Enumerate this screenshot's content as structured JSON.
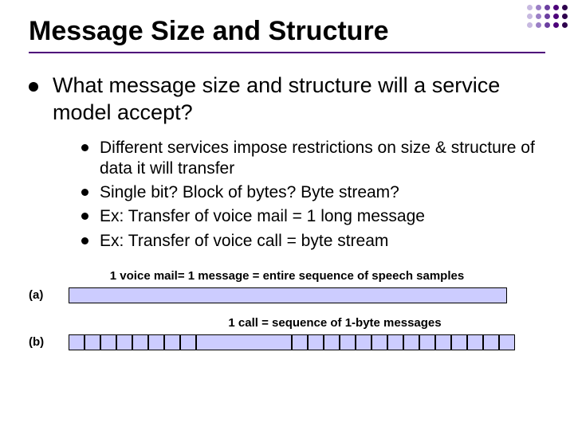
{
  "title": "Message Size and Structure",
  "main_bullet": "What message size and structure will a service model accept?",
  "sub_bullets": [
    "Different services impose restrictions on size & structure of data it will transfer",
    "Single bit?  Block of bytes?  Byte stream?",
    "Ex: Transfer of voice mail = 1 long message",
    "Ex: Transfer of voice call = byte stream"
  ],
  "diagram": {
    "caption_a": "1 voice mail= 1 message = entire sequence of speech samples",
    "label_a": "(a)",
    "caption_b": "1 call = sequence of 1-byte messages",
    "label_b": "(b)",
    "bar_b_segments": [
      {
        "w": "s"
      },
      {
        "w": "s"
      },
      {
        "w": "s"
      },
      {
        "w": "s"
      },
      {
        "w": "s"
      },
      {
        "w": "s"
      },
      {
        "w": "s"
      },
      {
        "w": "s"
      },
      {
        "w": "m"
      },
      {
        "w": "s"
      },
      {
        "w": "s"
      },
      {
        "w": "s"
      },
      {
        "w": "s"
      },
      {
        "w": "s"
      },
      {
        "w": "s"
      },
      {
        "w": "s"
      },
      {
        "w": "s"
      },
      {
        "w": "s"
      },
      {
        "w": "s"
      },
      {
        "w": "s"
      },
      {
        "w": "s"
      },
      {
        "w": "s"
      },
      {
        "w": "s"
      }
    ]
  },
  "corner_colors": [
    "#c7b9e0",
    "#9b7fc6",
    "#6b3fa0",
    "#4d017a",
    "#2e004d"
  ]
}
